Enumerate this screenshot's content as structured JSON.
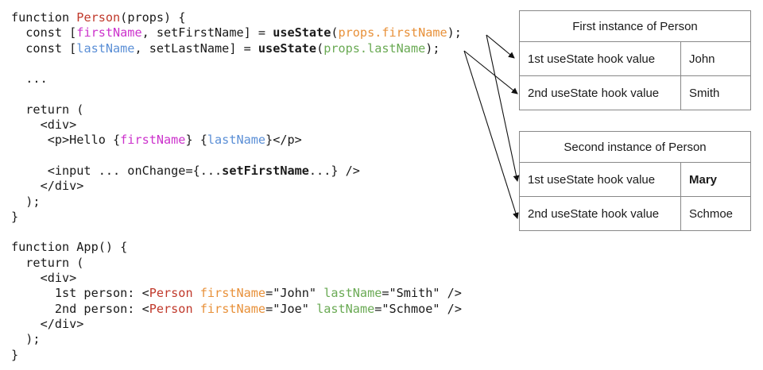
{
  "code_lines": [
    [
      {
        "t": "function "
      },
      {
        "t": "Person",
        "c": "comp"
      },
      {
        "t": "(props) {"
      }
    ],
    [
      {
        "t": "  const ["
      },
      {
        "t": "firstName",
        "c": "state"
      },
      {
        "t": ", setFirstName] = "
      },
      {
        "t": "useState",
        "c": "bold"
      },
      {
        "t": "("
      },
      {
        "t": "props.firstName",
        "c": "prop"
      },
      {
        "t": ");"
      }
    ],
    [
      {
        "t": "  const ["
      },
      {
        "t": "lastName",
        "c": "last"
      },
      {
        "t": ", setLastName] = "
      },
      {
        "t": "useState",
        "c": "bold"
      },
      {
        "t": "("
      },
      {
        "t": "props.lastName",
        "c": "prop2"
      },
      {
        "t": ");"
      }
    ],
    [
      {
        "t": ""
      }
    ],
    [
      {
        "t": "  ..."
      }
    ],
    [
      {
        "t": ""
      }
    ],
    [
      {
        "t": "  return ("
      }
    ],
    [
      {
        "t": "    <div>"
      }
    ],
    [
      {
        "t": "     <p>Hello {"
      },
      {
        "t": "firstName",
        "c": "state"
      },
      {
        "t": "} {"
      },
      {
        "t": "lastName",
        "c": "last"
      },
      {
        "t": "}</p>"
      }
    ],
    [
      {
        "t": ""
      }
    ],
    [
      {
        "t": "     <input ... onChange={..."
      },
      {
        "t": "setFirstName",
        "c": "bold"
      },
      {
        "t": "...} />"
      }
    ],
    [
      {
        "t": "    </div>"
      }
    ],
    [
      {
        "t": "  );"
      }
    ],
    [
      {
        "t": "}"
      }
    ],
    [
      {
        "t": ""
      }
    ],
    [
      {
        "t": "function App() {"
      }
    ],
    [
      {
        "t": "  return ("
      }
    ],
    [
      {
        "t": "    <div>"
      }
    ],
    [
      {
        "t": "      1st person: <"
      },
      {
        "t": "Person",
        "c": "comp"
      },
      {
        "t": " "
      },
      {
        "t": "firstName",
        "c": "attr1"
      },
      {
        "t": "=\"John\" "
      },
      {
        "t": "lastName",
        "c": "attr2"
      },
      {
        "t": "=\"Smith\" />"
      }
    ],
    [
      {
        "t": "      2nd person: <"
      },
      {
        "t": "Person",
        "c": "comp"
      },
      {
        "t": " "
      },
      {
        "t": "firstName",
        "c": "attr1"
      },
      {
        "t": "=\"Joe\" "
      },
      {
        "t": "lastName",
        "c": "attr2"
      },
      {
        "t": "=\"Schmoe\" />"
      }
    ],
    [
      {
        "t": "    </div>"
      }
    ],
    [
      {
        "t": "  );"
      }
    ],
    [
      {
        "t": "}"
      }
    ]
  ],
  "instances": [
    {
      "title": "First instance of Person",
      "rows": [
        {
          "label": "1st useState hook value",
          "value": "John",
          "bold": false
        },
        {
          "label": "2nd useState hook value",
          "value": "Smith",
          "bold": false
        }
      ]
    },
    {
      "title": "Second instance of Person",
      "rows": [
        {
          "label": "1st useState hook value",
          "value": "Mary",
          "bold": true
        },
        {
          "label": "2nd useState hook value",
          "value": "Schmoe",
          "bold": false
        }
      ]
    }
  ],
  "colors": {
    "component": "#c0392b",
    "first_state": "#cc33cc",
    "last_state": "#5b8fd6",
    "prop_first": "#e8913a",
    "prop_last": "#6aaa54",
    "border": "#888888"
  }
}
